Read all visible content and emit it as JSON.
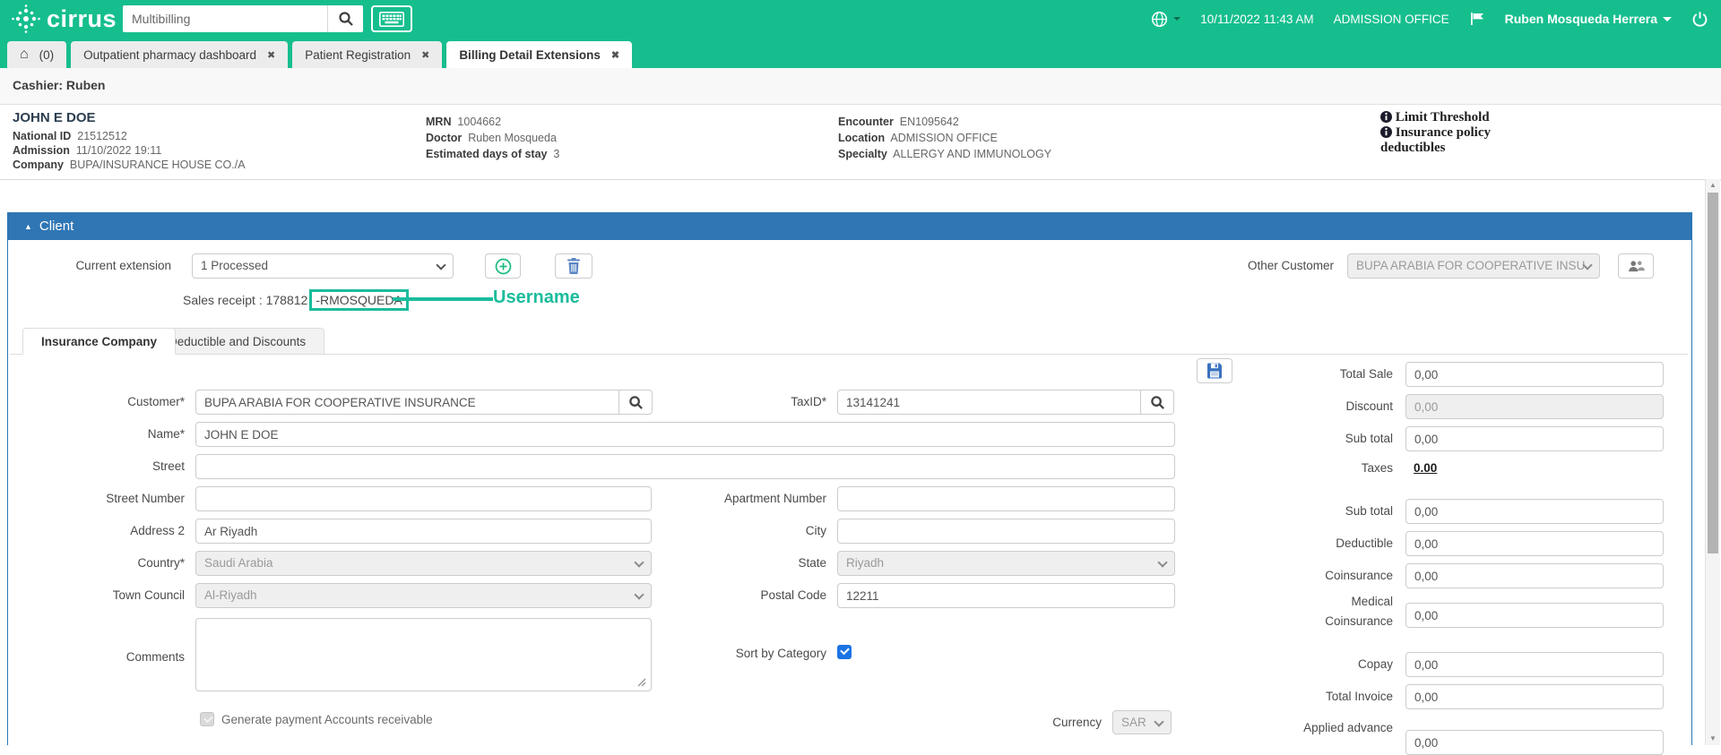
{
  "colors": {
    "brand_green": "#16be8e",
    "section_blue": "#2f76b4",
    "annotation_teal": "#1abc9c",
    "checkbox_blue": "#1b74e4",
    "trash_icon_blue": "#5b87c5",
    "printer_blue": "#1d4f91"
  },
  "icons": {
    "close": "✖",
    "home": "⌂",
    "triangle_up": "▲",
    "scroll_up": "▲",
    "scroll_down": "▼"
  },
  "header": {
    "logo_text": "cirrus",
    "search_value": "Multibilling",
    "datetime": "10/11/2022 11:43 AM",
    "office": "ADMISSION OFFICE",
    "user_name": "Ruben Mosqueda Herrera"
  },
  "tabs": {
    "home_label": "(0)",
    "items": [
      {
        "label": "Outpatient pharmacy dashboard"
      },
      {
        "label": "Patient Registration"
      },
      {
        "label": "Billing Detail Extensions"
      }
    ]
  },
  "cashier_bar": {
    "label": "Cashier: Ruben"
  },
  "patient": {
    "name": "JOHN E DOE",
    "rows_col1": [
      {
        "label": "National ID",
        "value": "21512512"
      },
      {
        "label": "Admission",
        "value": "11/10/2022 19:11"
      },
      {
        "label": "Company",
        "value": "BUPA/INSURANCE HOUSE CO./A"
      }
    ],
    "rows_col2": [
      {
        "label": "MRN",
        "value": "1004662"
      },
      {
        "label": "Doctor",
        "value": "Ruben Mosqueda"
      },
      {
        "label": "Estimated days of stay",
        "value": "3"
      }
    ],
    "rows_col3": [
      {
        "label": "Encounter",
        "value": "EN1095642"
      },
      {
        "label": "Location",
        "value": "ADMISSION OFFICE"
      },
      {
        "label": "Specialty",
        "value": "ALLERGY AND IMMUNOLOGY"
      }
    ],
    "info_links": [
      {
        "label": "Limit Threshold"
      },
      {
        "label": "Insurance policy deductibles"
      }
    ]
  },
  "client": {
    "section_title": "Client",
    "current_extension_label": "Current extension",
    "current_extension_value": "1 Processed",
    "other_customer_label": "Other Customer",
    "other_customer_value": "BUPA ARABIA FOR COOPERATIVE INSU",
    "sales_receipt_prefix": "Sales receipt : 178812",
    "sales_receipt_highlight": "-RMOSQUEDA",
    "annotation_label": "Username"
  },
  "form_tabs": {
    "insurance": "Insurance Company",
    "deductible": "Deductible and Discounts"
  },
  "form": {
    "customer_label": "Customer*",
    "customer_value": "BUPA ARABIA FOR COOPERATIVE INSURANCE",
    "taxid_label": "TaxID*",
    "taxid_value": "13141241",
    "name_label": "Name*",
    "name_value": "JOHN E DOE",
    "street_label": "Street",
    "street_value": "",
    "street_number_label": "Street Number",
    "street_number_value": "",
    "apartment_label": "Apartment Number",
    "apartment_value": "",
    "address2_label": "Address 2",
    "address2_value": "Ar Riyadh",
    "city_label": "City",
    "city_value": "",
    "country_label": "Country*",
    "country_value": "Saudi Arabia",
    "state_label": "State",
    "state_value": "Riyadh",
    "town_council_label": "Town Council",
    "town_council_value": "Al-Riyadh",
    "postal_label": "Postal Code",
    "postal_value": "12211",
    "comments_label": "Comments",
    "comments_value": "",
    "sort_by_category_label": "Sort by Category",
    "generate_payment_label": "Generate payment Accounts receivable",
    "currency_label": "Currency",
    "currency_value": "SAR"
  },
  "totals": {
    "rows": [
      {
        "label": "Total Sale",
        "value": "0,00"
      },
      {
        "label": "Discount",
        "value": "0,00"
      },
      {
        "label": "Sub total",
        "value": "0,00"
      },
      {
        "label": "Taxes",
        "value": "0.00"
      },
      {
        "label": "Sub total",
        "value": "0,00"
      },
      {
        "label": "Deductible",
        "value": "0,00"
      },
      {
        "label": "Coinsurance",
        "value": "0,00"
      },
      {
        "label": "Medical Coinsurance",
        "value": "0,00"
      },
      {
        "label": "Copay",
        "value": "0,00"
      },
      {
        "label": "Total Invoice",
        "value": "0,00"
      },
      {
        "label": "Applied advance",
        "value": "0,00"
      }
    ]
  }
}
